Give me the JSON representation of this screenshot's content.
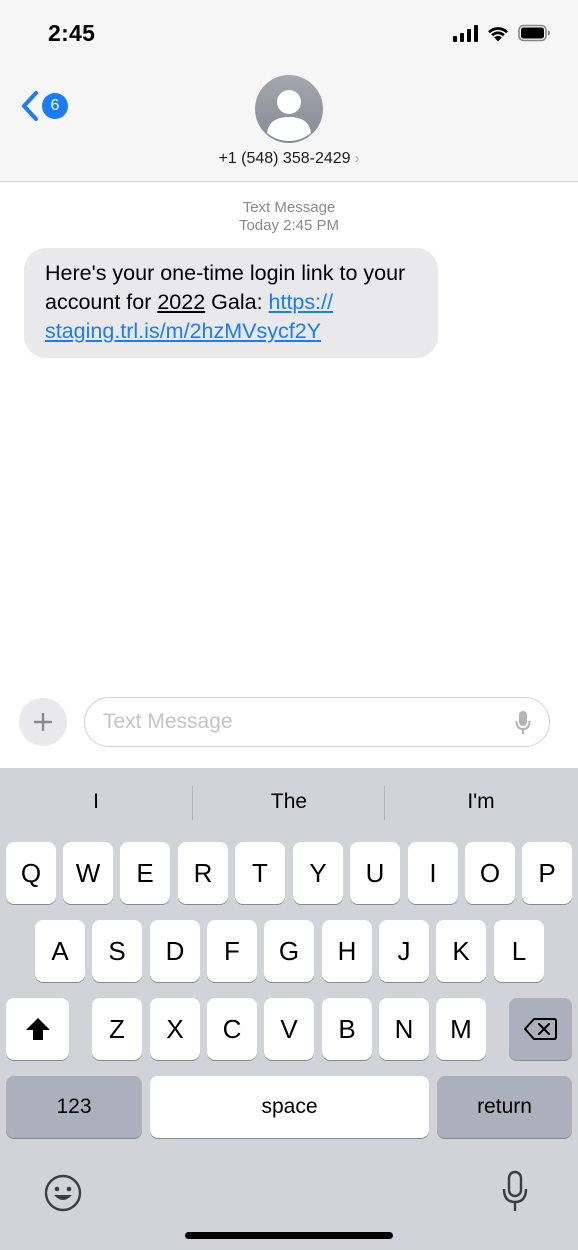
{
  "status_bar": {
    "time": "2:45"
  },
  "header": {
    "back_badge": "6",
    "contact": "+1 (548) 358-2429",
    "chevron": "›"
  },
  "conversation": {
    "meta_label": "Text Message",
    "meta_time": "Today 2:45 PM",
    "message": {
      "text_before": "Here's your one-time login link to your account for ",
      "number": "2022",
      "text_middle": " Gala: ",
      "link_line1": "https://",
      "link_line2": "staging.trl.is/m/2hzMVsycf2Y"
    }
  },
  "input": {
    "placeholder": "Text Message",
    "plus": "+"
  },
  "keyboard": {
    "suggestions": [
      "I",
      "The",
      "I'm"
    ],
    "row1": [
      "Q",
      "W",
      "E",
      "R",
      "T",
      "Y",
      "U",
      "I",
      "O",
      "P"
    ],
    "row2": [
      "A",
      "S",
      "D",
      "F",
      "G",
      "H",
      "J",
      "K",
      "L"
    ],
    "row3": [
      "Z",
      "X",
      "C",
      "V",
      "B",
      "N",
      "M"
    ],
    "numbers_key": "123",
    "space_key": "space",
    "return_key": "return"
  },
  "colors": {
    "accent": "#1a7cf7",
    "bubble": "#e9e9eb",
    "keyboard_bg": "#d1d3d9",
    "dark_key": "#abb0bc"
  },
  "icons": [
    "back-chevron-icon",
    "person-icon",
    "plus-icon",
    "mic-icon",
    "shift-icon",
    "delete-icon",
    "emoji-icon",
    "dictation-icon",
    "signal-icon",
    "wifi-icon",
    "battery-icon"
  ]
}
